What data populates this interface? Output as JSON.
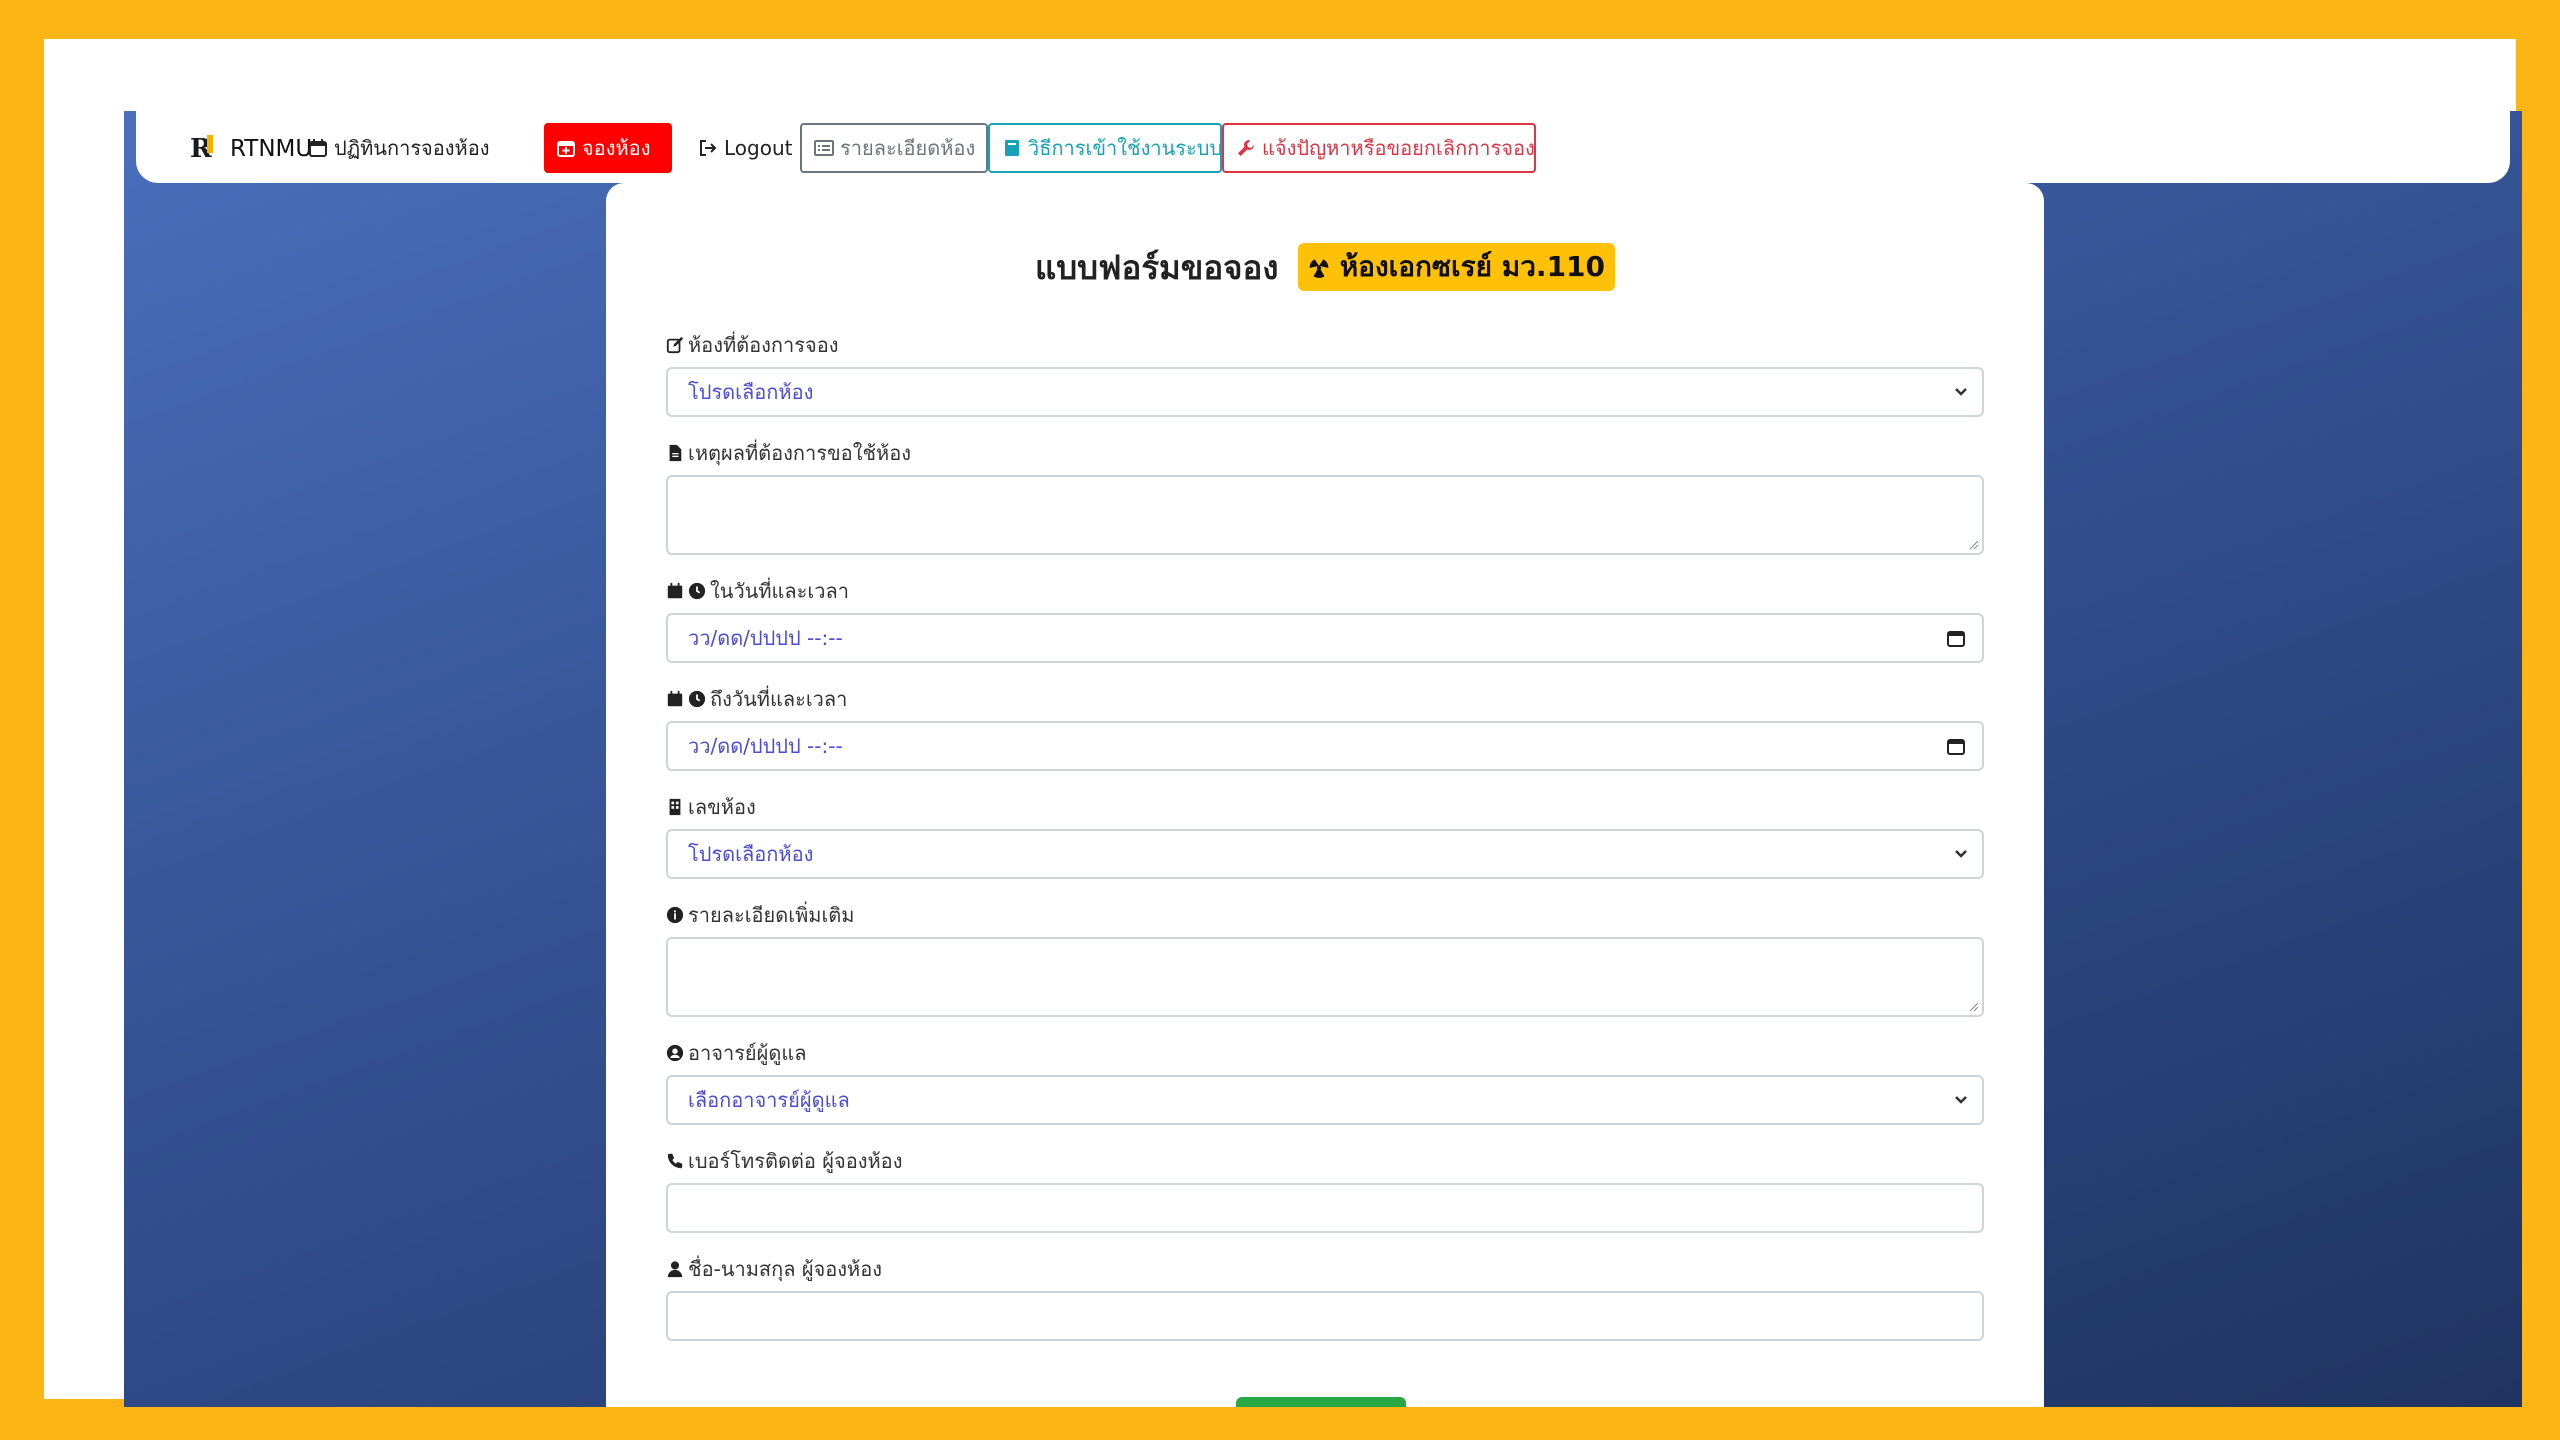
{
  "nav": {
    "brand": "RTNMU",
    "calendar": "ปฏิทินการจองห้อง",
    "book": "จองห้อง",
    "logout": "Logout",
    "room_details": "รายละเอียดห้อง",
    "how_to": "วิธีการเข้าใช้งานระบบ",
    "report": "แจ้งปัญหาหรือขอยกเลิกการจอง"
  },
  "form": {
    "title": "แบบฟอร์มขอจอง",
    "room_badge": "ห้องเอกซเรย์ มว.110",
    "room_label": "ห้องที่ต้องการจอง",
    "room_value": "โปรดเลือกห้อง",
    "reason_label": "เหตุผลที่ต้องการขอใช้ห้อง",
    "reason_value": "",
    "start_label": "ในวันที่และเวลา",
    "start_value": "วว/ดด/ปปปป --:--",
    "end_label": "ถึงวันที่และเวลา",
    "end_value": "วว/ดด/ปปปป --:--",
    "roomno_label": "เลขห้อง",
    "roomno_value": "โปรดเลือกห้อง",
    "details_label": "รายละเอียดเพิ่มเติม",
    "details_value": "",
    "advisor_label": "อาจารย์ผู้ดูแล",
    "advisor_value": "เลือกอาจารย์ผู้ดูแล",
    "phone_label": "เบอร์โทรติดต่อ ผู้จองห้อง",
    "phone_value": "",
    "name_label": "ชื่อ-นามสกุล ผู้จองห้อง",
    "name_value": ""
  },
  "icons": {
    "calendar": "calendar-icon",
    "calendar_plus": "calendar-plus-icon",
    "logout": "sign-out-icon",
    "list": "list-icon",
    "book": "book-icon",
    "wrench": "wrench-icon",
    "radiation": "radiation-icon",
    "edit": "edit-icon",
    "file": "file-icon",
    "clock": "clock-icon",
    "building": "building-icon",
    "info": "info-icon",
    "user_circle": "user-circle-icon",
    "phone": "phone-icon",
    "user": "user-icon",
    "chevron": "chevron-down-icon"
  },
  "colors": {
    "frame": "#FDB515",
    "book_button": "#FF0000",
    "secondary": "#6C757D",
    "info": "#17A2B8",
    "danger": "#DC3545",
    "badge": "#FFC107",
    "submit": "#28A745",
    "input_text": "#4B4BD6"
  }
}
